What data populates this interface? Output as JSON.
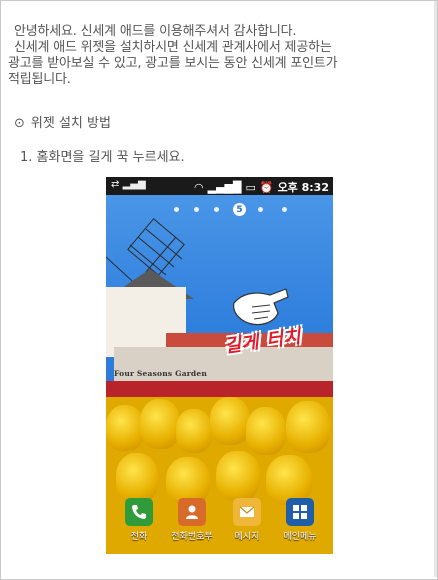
{
  "intro": {
    "line1": "안녕하세요. 신세계 애드를 이용해주셔서 감사합니다.",
    "line2": "신세계 애드 위젯을 설치하시면 신세계 관계사에서 제공하는",
    "line3": "광고를 받아보실 수 있고, 광고를 보시는 동안 신세계 포인트가",
    "line4": "적립됩니다."
  },
  "section": {
    "bullet": "⊙",
    "title": "위젯 설치 방법"
  },
  "steps": [
    {
      "label": "1. 홈화면을 길게 꾹 누르세요."
    }
  ],
  "phone": {
    "status_bar": {
      "time": "오후 8:32"
    },
    "page_indicator": {
      "active_page": "5"
    },
    "overlay_text": "길게 터치",
    "sign_text": "Four Seasons Garden",
    "dock": [
      {
        "label": "전화",
        "icon": "phone-icon",
        "color": "#2f9b3a"
      },
      {
        "label": "전화번호부",
        "icon": "contacts-icon",
        "color": "#d86a2a"
      },
      {
        "label": "메시지",
        "icon": "message-icon",
        "color": "#f0b63a"
      },
      {
        "label": "메인메뉴",
        "icon": "apps-icon",
        "color": "#1f5fa8"
      }
    ]
  }
}
